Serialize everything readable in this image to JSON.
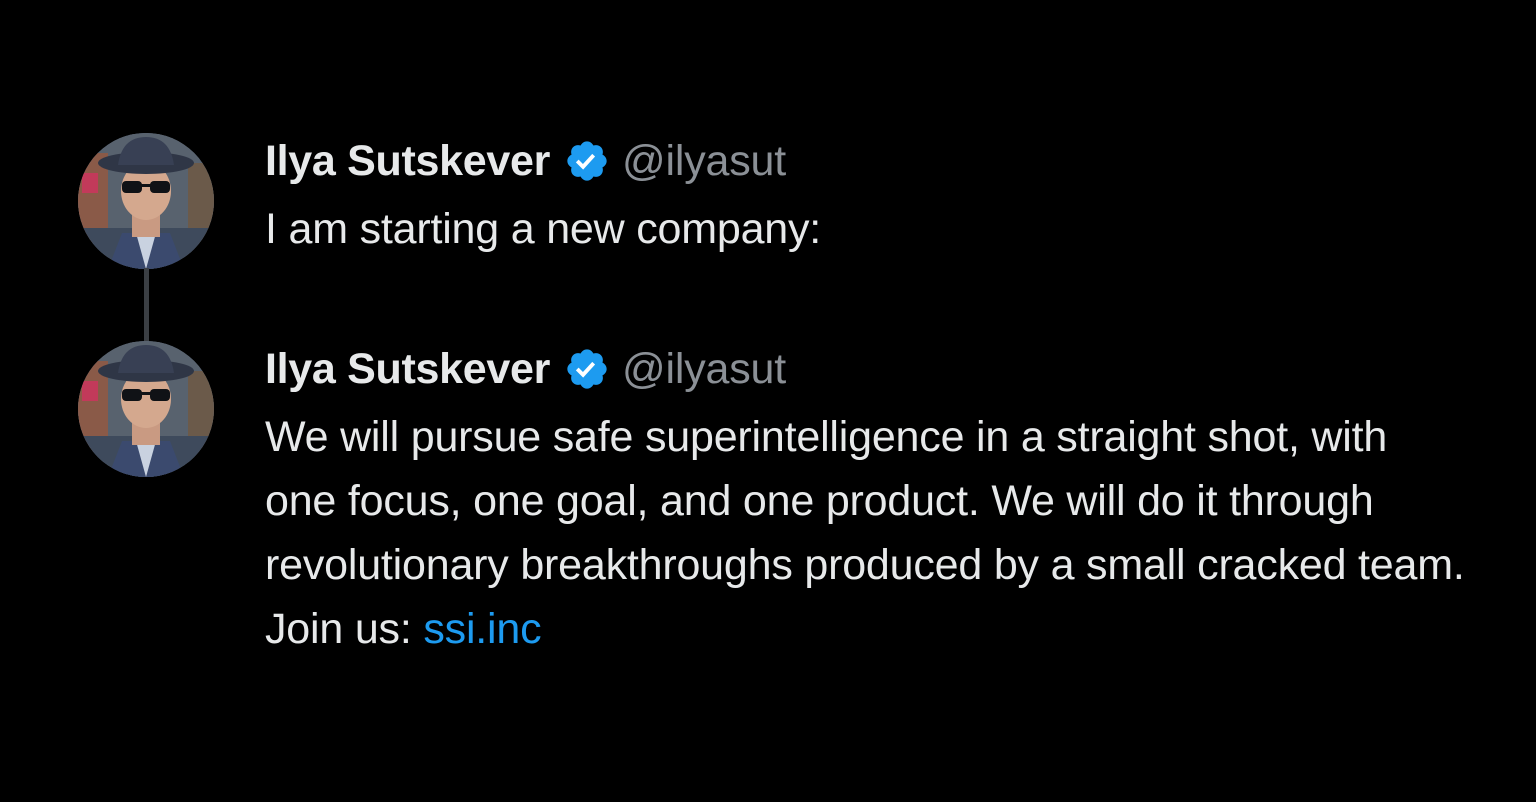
{
  "tweets": [
    {
      "display_name": "Ilya Sutskever",
      "verified_icon": "verified-badge-icon",
      "handle": "@ilyasut",
      "text": "I am starting a new company:",
      "link": ""
    },
    {
      "display_name": "Ilya Sutskever",
      "verified_icon": "verified-badge-icon",
      "handle": "@ilyasut",
      "text": "We will pursue safe superintelligence in a straight shot, with one focus, one goal, and one product. We will do it through revolutionary breakthroughs produced by a small cracked team. Join us: ",
      "link": "ssi.inc"
    }
  ],
  "colors": {
    "background": "#000000",
    "text": "#e7e9ea",
    "handle": "#8b9096",
    "link": "#1d9bf0",
    "verified": "#1d9bf0",
    "thread_line": "#3b3f44"
  }
}
